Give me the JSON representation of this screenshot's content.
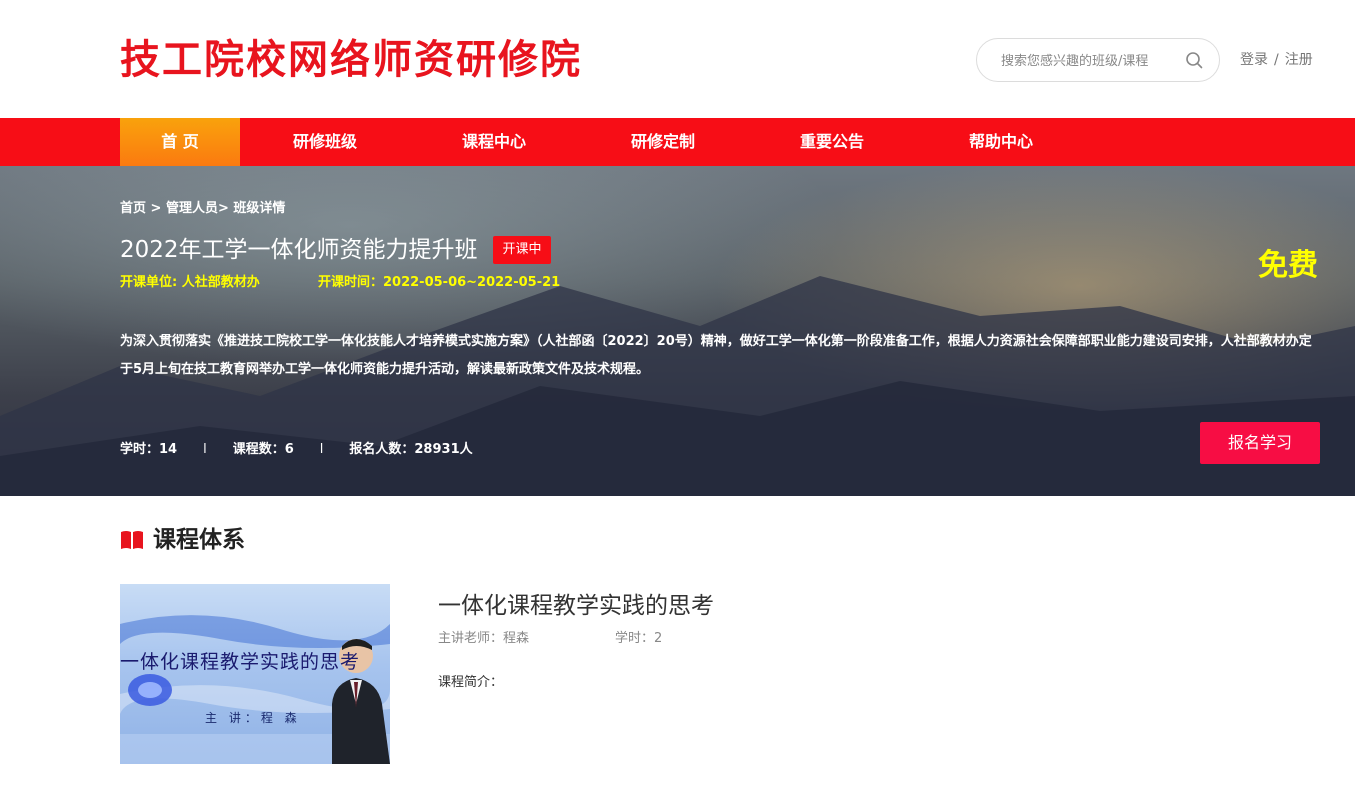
{
  "header": {
    "logo_text": "技工院校网络师资研修院",
    "search_placeholder": "搜索您感兴趣的班级/课程",
    "login_label": "登录",
    "separator": "/",
    "register_label": "注册"
  },
  "nav": {
    "items": [
      {
        "label": "首 页",
        "active": true
      },
      {
        "label": "研修班级"
      },
      {
        "label": "课程中心"
      },
      {
        "label": "研修定制"
      },
      {
        "label": "重要公告"
      },
      {
        "label": "帮助中心"
      }
    ]
  },
  "banner": {
    "breadcrumb": "首页 > 管理人员> 班级详情",
    "title": "2022年工学一体化师资能力提升班",
    "status": "开课中",
    "organizer": "开课单位: 人社部教材办",
    "period": "开课时间：2022-05-06~2022-05-21",
    "price": "免费",
    "description": "为深入贯彻落实《推进技工院校工学一体化技能人才培养模式实施方案》（人社部函〔2022〕20号）精神，做好工学一体化第一阶段准备工作，根据人力资源社会保障部职业能力建设司安排，人社部教材办定于5月上旬在技工教育网举办工学一体化师资能力提升活动，解读最新政策文件及技术规程。",
    "stats": {
      "hours": "学时：14",
      "courses": "课程数：6",
      "enrolled": "报名人数：28931人",
      "divider": "l"
    },
    "enroll_label": "报名学习"
  },
  "section": {
    "title": "课程体系"
  },
  "course": {
    "thumb_title": "一体化课程教学实践的思考",
    "thumb_speaker": "主 讲：程  森",
    "name": "一体化课程教学实践的思考",
    "teacher": "主讲老师：程森",
    "hours": "学时：2",
    "intro_label": "课程简介："
  },
  "colors": {
    "brand_red": "#f70d16",
    "active_nav": "#fb8a0e",
    "highlight_yellow": "#ffff00",
    "enroll_button": "#f70d44"
  }
}
